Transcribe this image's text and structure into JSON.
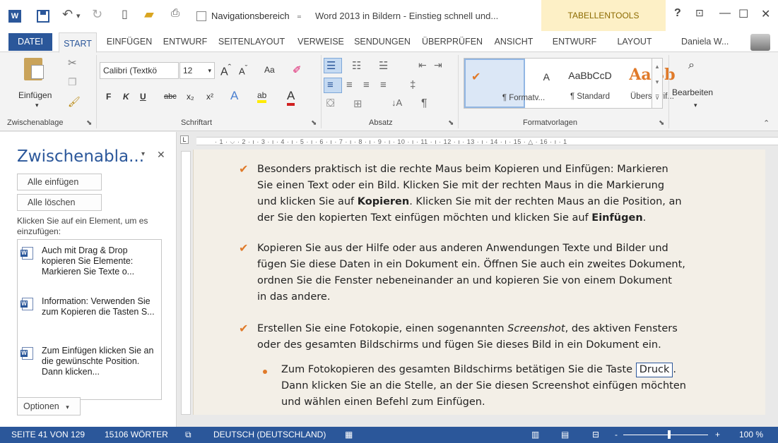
{
  "titlebar": {
    "nav_pane_label": "Navigationsbereich",
    "doc_title": "Word 2013 in Bildern - Einstieg schnell und...",
    "tabellentools": "TABELLENTOOLS",
    "help": "?",
    "minimize": "—",
    "maximize": "☐",
    "close": "✕"
  },
  "tabs": {
    "datei": "DATEI",
    "start": "START",
    "einfuegen": "EINFÜGEN",
    "entwurf": "ENTWURF",
    "seitenlayout": "SEITENLAYOUT",
    "verweise": "VERWEISE",
    "sendungen": "SENDUNGEN",
    "ueberpruefen": "ÜBERPRÜFEN",
    "ansicht": "ANSICHT",
    "tt_entwurf": "ENTWURF",
    "tt_layout": "LAYOUT",
    "user": "Daniela W..."
  },
  "ribbon": {
    "clipboard": {
      "paste_label": "Einfügen",
      "group": "Zwischenablage"
    },
    "font": {
      "family": "Calibri (Textkö",
      "size": "12",
      "group": "Schriftart",
      "bold": "F",
      "italic": "K",
      "underline": "U",
      "strike": "abc",
      "sub": "x₂",
      "sup": "x²",
      "aa": "Aa"
    },
    "paragraph": {
      "group": "Absatz"
    },
    "styles": {
      "group": "Formatvorlagen",
      "items": [
        {
          "preview": "A",
          "label": "¶ Formatv..."
        },
        {
          "preview": "AaBbCcD",
          "label": "¶ Standard"
        },
        {
          "preview": "AaBb",
          "label": "Überschrif..."
        }
      ]
    },
    "editing": {
      "label": "Bearbeiten"
    }
  },
  "clip_pane": {
    "title": "Zwischenabla...",
    "paste_all": "Alle einfügen",
    "clear_all": "Alle löschen",
    "hint": "Klicken Sie auf ein Element, um es einzufügen:",
    "items": [
      {
        "text": "Auch mit Drag & Drop kopieren Sie Elemente: Markieren Sie Texte o..."
      },
      {
        "text": "Information: Verwenden Sie zum Kopieren die Tasten S..."
      },
      {
        "text": "Zum Einfügen klicken Sie an die gewünschte Position. Dann klicken..."
      }
    ],
    "options": "Optionen"
  },
  "ruler": {
    "marks": "· 1 · ⌵ · 2 · ı · 3 · ı · 4 · ı · 5 · ı · 6 · ı · 7 · ı · 8 · ı · 9 · ı · 10 · ı · 11 · ı · 12 · ı · 13 · ı · 14 · ı · 15 · △ · 16 · ı · 1"
  },
  "document": {
    "p1": [
      "Besonders praktisch ist die rechte Maus beim Kopieren und Einfügen: Markieren",
      "Sie einen Text oder ein Bild. Klicken Sie mit der rechten Maus in die Markierung",
      "und klicken Sie auf ",
      "Kopieren",
      ". Klicken Sie mit der rechten Maus an die Position, an",
      "der Sie den kopierten Text einfügen möchten und klicken Sie auf ",
      "Einfügen",
      "."
    ],
    "p2": [
      "Kopieren Sie aus der Hilfe oder aus anderen Anwendungen Texte und Bilder und",
      "fügen Sie diese Daten in ein Dokument ein. Öffnen Sie auch ein zweites Dokument,",
      "ordnen Sie die Fenster nebeneinander an und kopieren Sie von einem Dokument",
      "in das andere."
    ],
    "p3": [
      "Erstellen Sie eine Fotokopie, einen sogenannten ",
      "Screenshot",
      ", des aktiven Fensters",
      "oder des gesamten Bildschirms und fügen Sie dieses Bild in ein Dokument ein."
    ],
    "p4": [
      "Zum Fotokopieren des gesamten Bildschirms betätigen Sie die Taste ",
      "Druck",
      ".",
      "Dann klicken Sie an die Stelle, an der Sie diesen Screenshot einfügen möchten",
      "und wählen einen Befehl zum Einfügen."
    ]
  },
  "status": {
    "page": "SEITE 41 VON 129",
    "words": "15106 WÖRTER",
    "language": "DEUTSCH (DEUTSCHLAND)",
    "zoom": "100 %",
    "zoom_minus": "-",
    "zoom_plus": "+"
  },
  "colors": {
    "accent": "#2b579a",
    "check": "#e07a2a",
    "page": "#f3efe7",
    "tabellentools": "#fdf0c6"
  }
}
